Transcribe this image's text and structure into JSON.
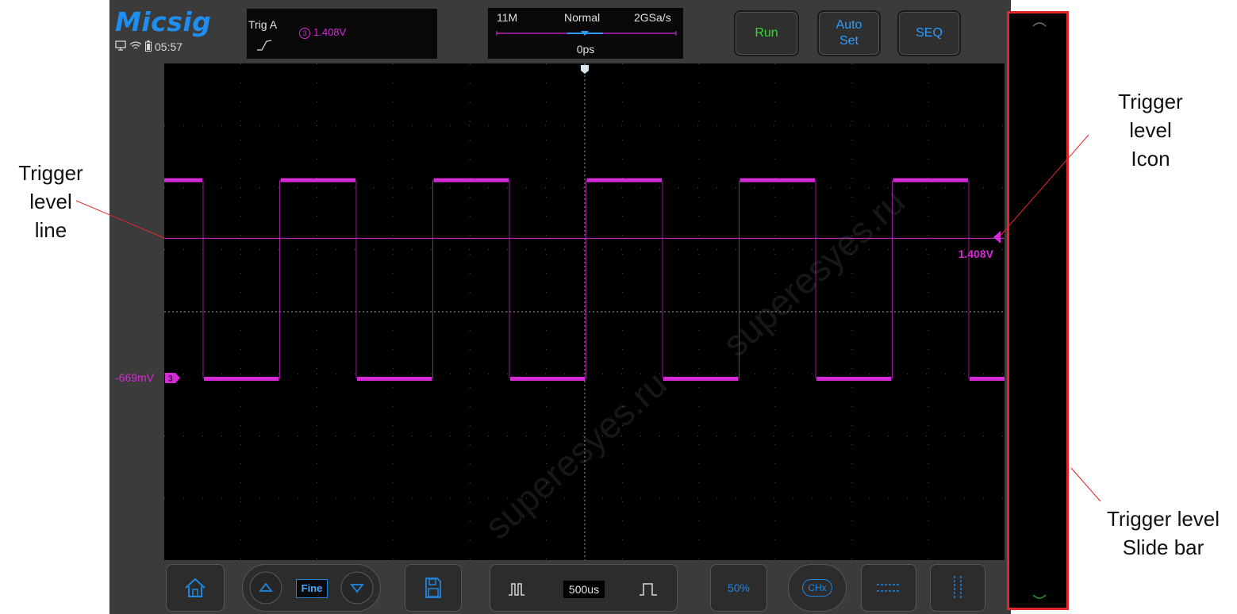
{
  "brand": {
    "logo": "Micsig",
    "clock": "05:57"
  },
  "trigger_box": {
    "label": "Trig  A",
    "channel_badge": "3",
    "level": "1.408V",
    "edge": "rising-edge-icon"
  },
  "time_box": {
    "memory_depth": "11M",
    "mode": "Normal",
    "sample_rate": "2GSa/s",
    "position": "0ps"
  },
  "buttons": {
    "run": "Run",
    "auto_set_line1": "Auto",
    "auto_set_line2": "Set",
    "seq": "SEQ"
  },
  "screen": {
    "trigger_level_readout": "1.408V",
    "channel_offset_label": "-669mV",
    "channel_marker": "3",
    "trace_color": "#d62ad6",
    "watermark": "superesyes.ru"
  },
  "waveform": {
    "high_level_fraction": 0.235,
    "low_level_fraction": 0.635,
    "trigger_level_fraction": 0.352,
    "center_fraction": 0.5
  },
  "toolbar": {
    "fine": "Fine",
    "timebase": "500us",
    "fifty_percent": "50%",
    "chx": "CHx"
  },
  "annotations": {
    "trigger_level_line": [
      "Trigger",
      "level",
      "line"
    ],
    "trigger_level_icon": [
      "Trigger",
      "level",
      "Icon"
    ],
    "trigger_level_slide_bar": [
      "Trigger level",
      "Slide bar"
    ]
  },
  "colors": {
    "accent_blue": "#1e8ff0",
    "run_green": "#35d835",
    "channel3_magenta": "#d62ad6",
    "annotation_red": "#e4262b"
  }
}
